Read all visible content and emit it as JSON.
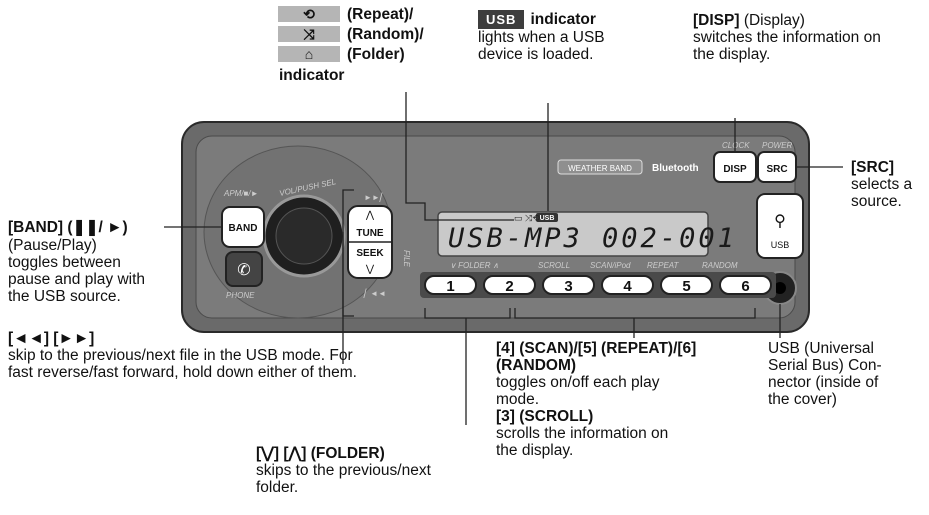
{
  "legend": {
    "repeat_label": "(Repeat)/",
    "random_label": "(Random)/",
    "folder_label": "(Folder)",
    "indicator_word": "indicator"
  },
  "usb_indicator": {
    "badge": "USB",
    "title": "indicator",
    "desc_line1": "lights when a USB",
    "desc_line2": "device is loaded."
  },
  "disp": {
    "key": "[DISP]",
    "paren": "(Display)",
    "line2": "switches the information on",
    "line3": "the display."
  },
  "src": {
    "key": "[SRC]",
    "line2": "selects a",
    "line3": "source."
  },
  "band": {
    "title": "[BAND] (❚❚/ ►)",
    "line2": "(Pause/Play)",
    "line3": "toggles between",
    "line4": "pause and play with",
    "line5": "the USB source."
  },
  "skip": {
    "title": "[◄◄] [►►]",
    "line2": "skip to the previous/next file in the USB mode. For",
    "line3": "fast reverse/fast forward, hold down either of them."
  },
  "folder": {
    "title": "[⋁] [⋀] (FOLDER)",
    "line2": "skips to the previous/next",
    "line3": "folder."
  },
  "modes": {
    "title1": "[4] (SCAN)/[5] (REPEAT)/[6]",
    "title2": "(RANDOM)",
    "line3": "toggles on/off each play",
    "line4": "mode.",
    "title5": "[3] (SCROLL)",
    "line6": "scrolls the information on",
    "line7": "the display."
  },
  "usbconn": {
    "line1": "USB (Universal",
    "line2": "Serial Bus) Con-",
    "line3": "nector (inside of",
    "line4": "the cover)"
  },
  "device": {
    "lcd_text": "USB-MP3 002-001",
    "lcd_badge": "USB",
    "weather": "WEATHER BAND",
    "bluetooth": "Bluetooth",
    "clock": "CLOCK",
    "power": "POWER",
    "disp_btn": "DISP",
    "src_btn": "SRC",
    "band_btn": "BAND",
    "tune": "TUNE",
    "seek": "SEEK",
    "file": "FILE",
    "apm": "APM/■/►",
    "vol": "VOL/PUSH SEL",
    "phone": "PHONE",
    "usb_port": "USB",
    "ff": "►►▏",
    "rw": "▏◄◄",
    "labels": [
      "∨ FOLDER ∧",
      "SCROLL",
      "SCAN/iPod",
      "REPEAT",
      "RANDOM"
    ],
    "numbers": [
      "1",
      "2",
      "3",
      "4",
      "5",
      "6"
    ]
  }
}
